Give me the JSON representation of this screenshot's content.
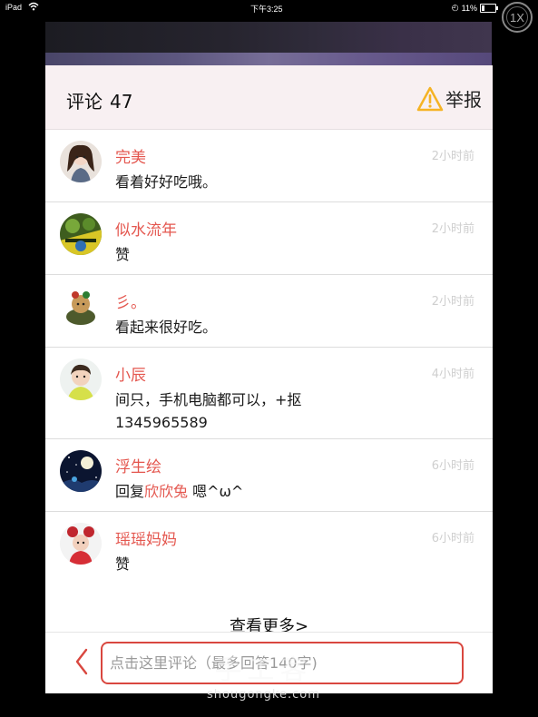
{
  "status_bar": {
    "device": "iPad",
    "time": "下午3:25",
    "battery": "11%",
    "zoom": "1X"
  },
  "header": {
    "title": "评论",
    "count": "47",
    "report_label": "举报"
  },
  "comments": [
    {
      "user": "完美",
      "time": "2小时前",
      "text": "看着好好吃哦。",
      "avatar": "avatar-girl"
    },
    {
      "user": "似水流年",
      "time": "2小时前",
      "text": "赞",
      "avatar": "avatar-green"
    },
    {
      "user": "彡。",
      "time": "2小时前",
      "text": "看起来很好吃。",
      "avatar": "avatar-toy"
    },
    {
      "user": "小辰",
      "time": "4小时前",
      "text": "间只，手机电脑都可以，+抠",
      "text2": "1345965589",
      "avatar": "avatar-boy"
    },
    {
      "user": "浮生绘",
      "time": "6小时前",
      "text_prefix": "回复",
      "reply_to": "欣欣兔",
      "text_suffix": " 嗯^ω^",
      "avatar": "avatar-night"
    },
    {
      "user": "瑶瑶妈妈",
      "time": "6小时前",
      "text": "赞",
      "avatar": "avatar-minnie"
    }
  ],
  "more_label": "查看更多>",
  "input": {
    "placeholder": "点击这里评论（最多回答140字)"
  },
  "watermark": {
    "title": "手工客",
    "url": "shougongke.com"
  },
  "colors": {
    "accent": "#e4574f",
    "header_bg": "#f8f0f2",
    "warning": "#f5b324"
  }
}
